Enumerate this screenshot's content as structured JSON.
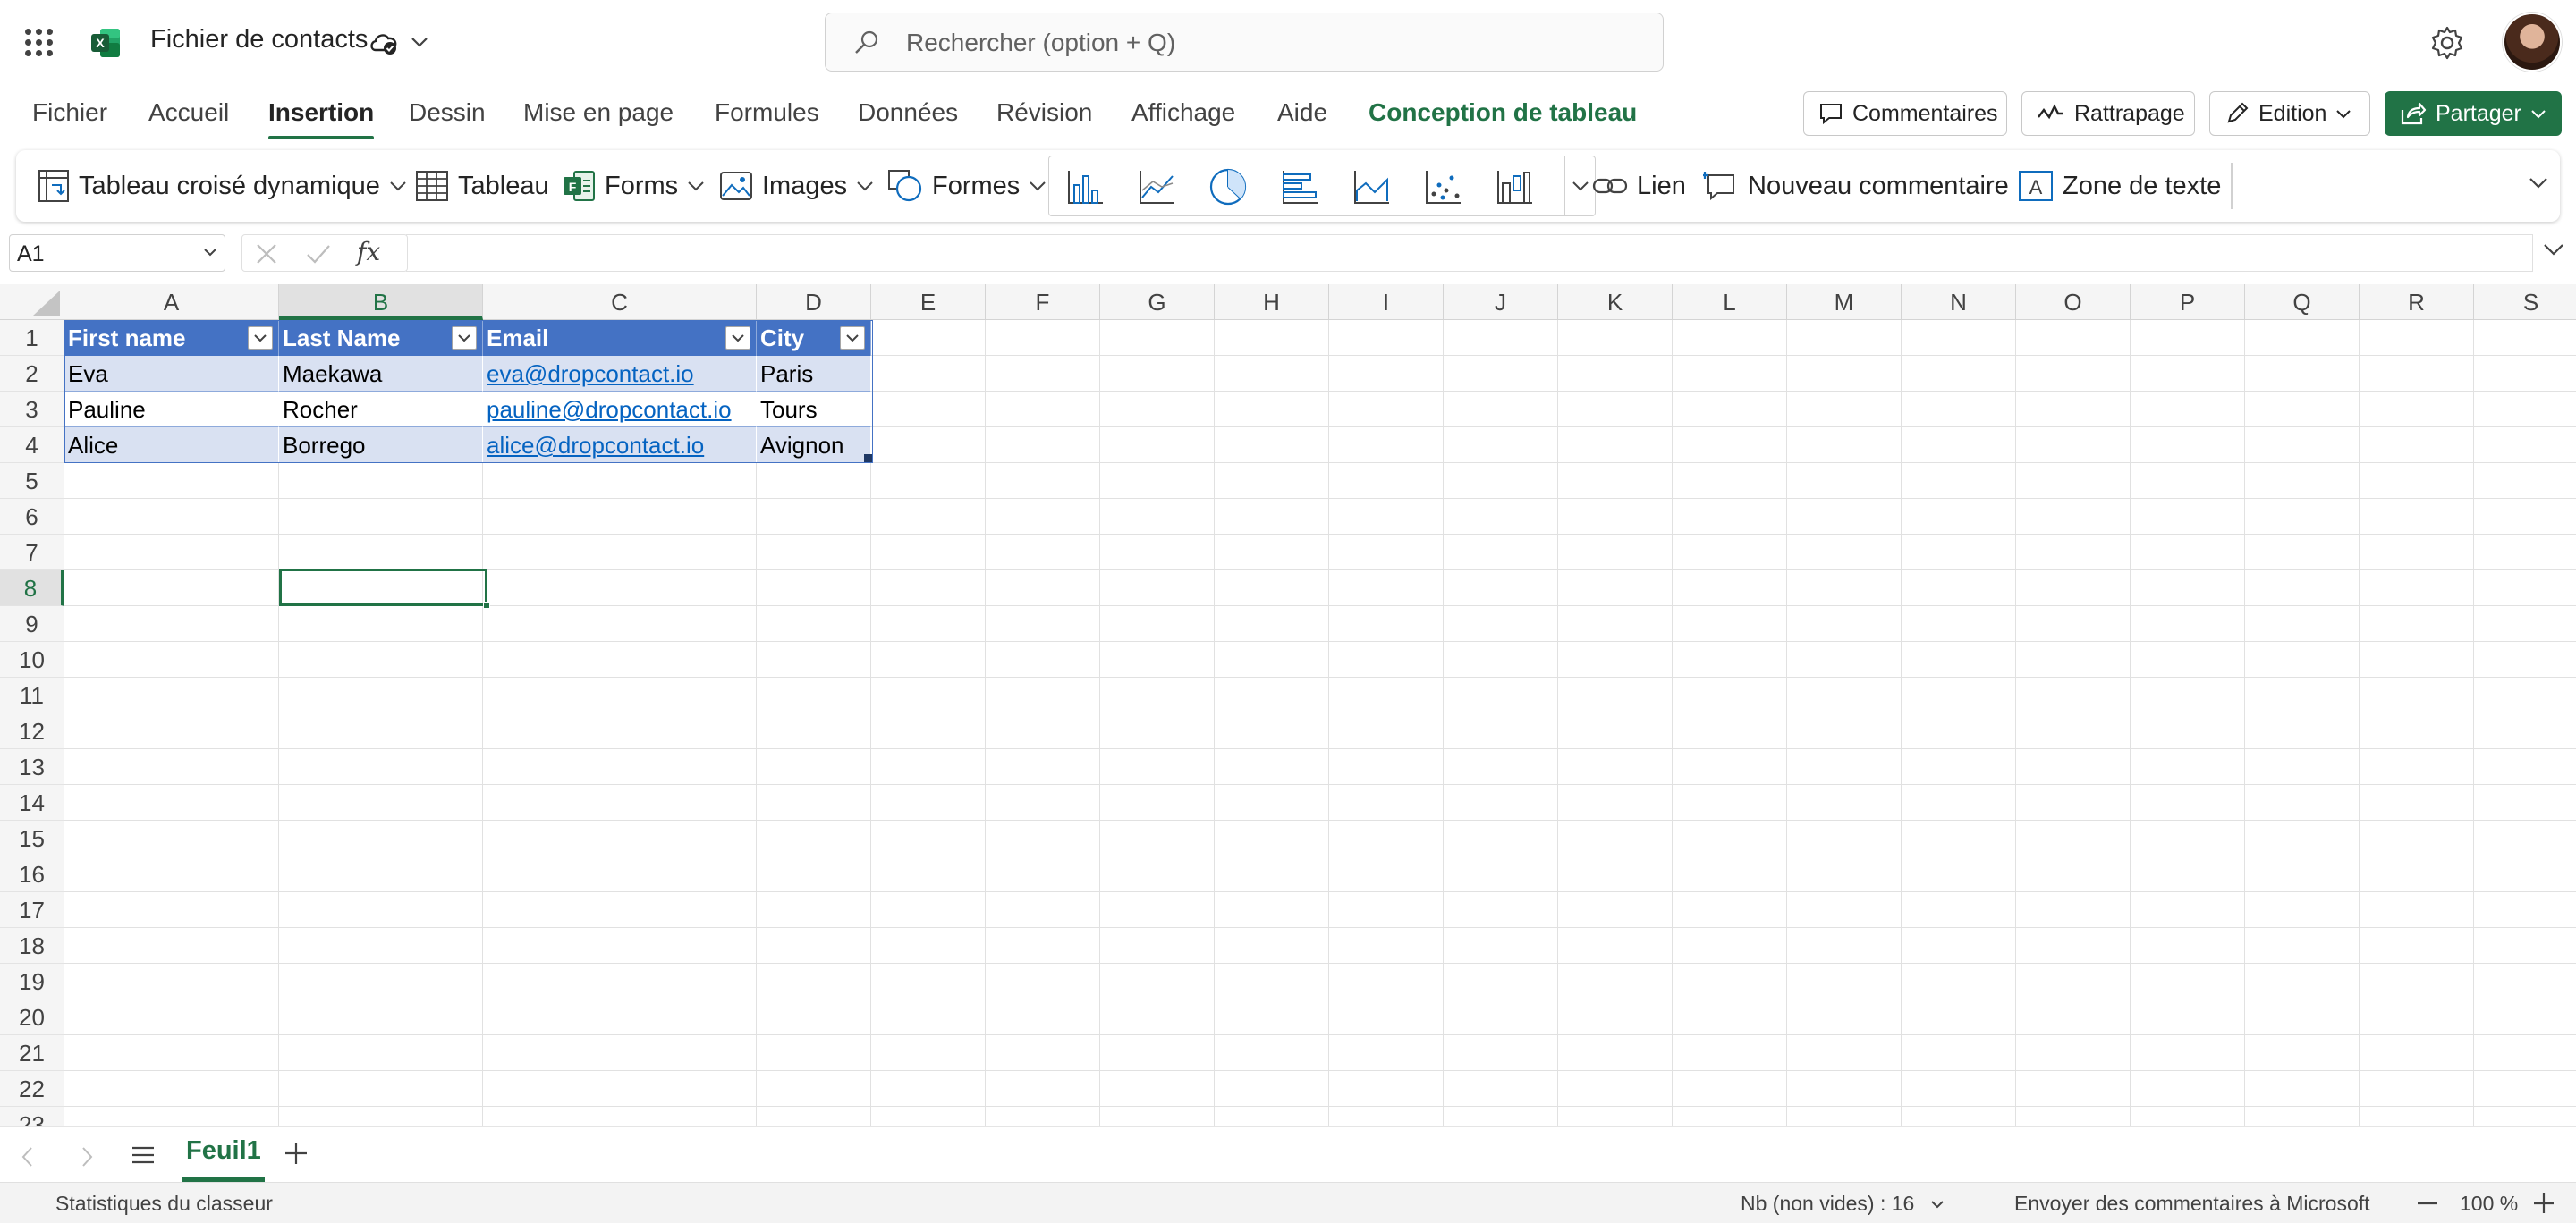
{
  "app": {
    "title": "Fichier de contacts",
    "search_placeholder": "Rechercher (option + Q)"
  },
  "menu": {
    "tabs": [
      {
        "label": "Fichier"
      },
      {
        "label": "Accueil"
      },
      {
        "label": "Insertion",
        "active": true
      },
      {
        "label": "Dessin"
      },
      {
        "label": "Mise en page"
      },
      {
        "label": "Formules"
      },
      {
        "label": "Données"
      },
      {
        "label": "Révision"
      },
      {
        "label": "Affichage"
      },
      {
        "label": "Aide"
      },
      {
        "label": "Conception de tableau",
        "contextual": true
      }
    ],
    "comments_label": "Commentaires",
    "catchup_label": "Rattrapage",
    "edit_label": "Edition",
    "share_label": "Partager"
  },
  "ribbon": {
    "pivot_label": "Tableau croisé dynamique",
    "table_label": "Tableau",
    "forms_label": "Forms",
    "images_label": "Images",
    "shapes_label": "Formes",
    "link_label": "Lien",
    "new_comment_label": "Nouveau commentaire",
    "textbox_label": "Zone de texte"
  },
  "formula_bar": {
    "cell_ref": "A1",
    "fx": "fx",
    "value": ""
  },
  "sheet": {
    "columns": [
      "A",
      "B",
      "C",
      "D",
      "E",
      "F",
      "G",
      "H",
      "I",
      "J",
      "K",
      "L",
      "M",
      "N",
      "O",
      "P",
      "Q",
      "R",
      "S"
    ],
    "selected_column": "B",
    "rows": [
      "1",
      "2",
      "3",
      "4",
      "5",
      "6",
      "7",
      "8",
      "9",
      "10",
      "11",
      "12",
      "13",
      "14",
      "15",
      "16",
      "17",
      "18",
      "19",
      "20",
      "21",
      "22",
      "23"
    ],
    "selected_row": "8",
    "selected_cell": "B8",
    "table": {
      "headers": [
        "First name",
        "Last Name",
        "Email",
        "City"
      ],
      "rows": [
        [
          "Eva",
          "Maekawa",
          "eva@dropcontact.io",
          "Paris"
        ],
        [
          "Pauline",
          "Rocher",
          "pauline@dropcontact.io",
          "Tours"
        ],
        [
          "Alice",
          "Borrego",
          "alice@dropcontact.io",
          "Avignon"
        ]
      ],
      "header_color": "#4472c4",
      "band_color": "#d9e1f2"
    }
  },
  "sheet_tabs": {
    "active": "Feuil1"
  },
  "status": {
    "workbook_stats": "Statistiques du classeur",
    "count": "Nb (non vides) : 16",
    "feedback": "Envoyer des commentaires à Microsoft",
    "zoom": "100 %"
  },
  "colors": {
    "accent": "#217346",
    "link": "#0563c1"
  }
}
